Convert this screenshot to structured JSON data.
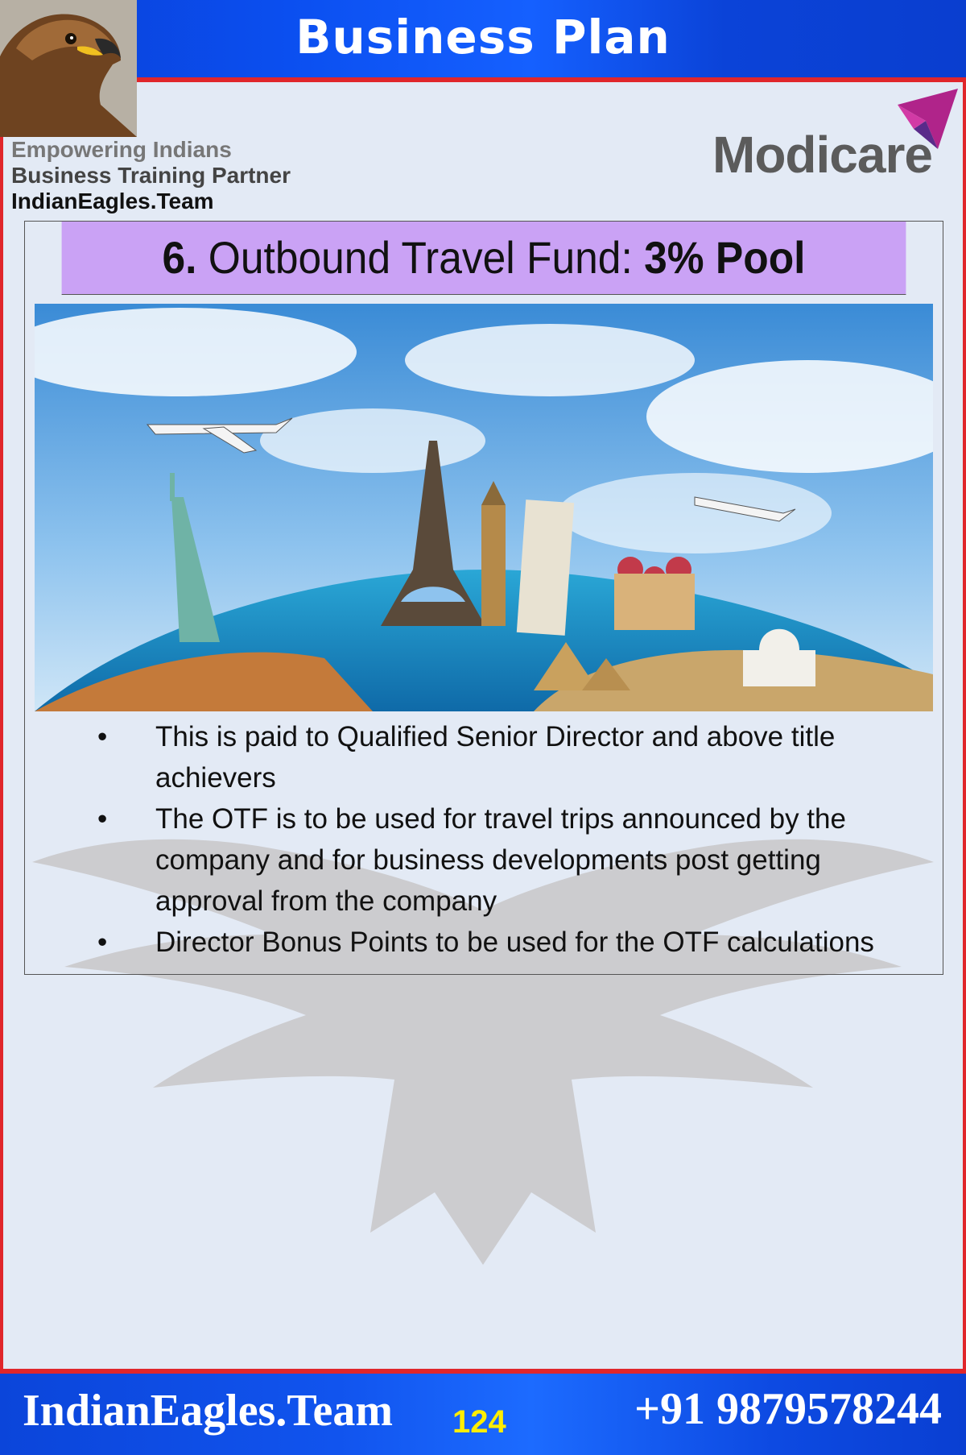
{
  "header": {
    "title": "Business Plan"
  },
  "branding": {
    "line1": "Empowering Indians",
    "line2": "Business Training Partner",
    "line3": "IndianEagles.Team",
    "logo_text": "Modicare"
  },
  "slide": {
    "title_number": "6.",
    "title_main": "Outbound Travel Fund:",
    "title_bold": "3% Pool",
    "bullets": [
      "This is paid to Qualified Senior Director and above title achievers",
      "The OTF is to be used for travel trips announced by the company and for business developments post getting approval from the company",
      "Director Bonus Points to be used for the OTF calculations"
    ]
  },
  "footer": {
    "site": "IndianEagles.Team",
    "page_number": "124",
    "phone": "+91 9879578244"
  },
  "colors": {
    "header_blue": "#0b4ff0",
    "accent_red": "#e0262b",
    "title_bar_purple": "#caa2f5",
    "page_number_yellow": "#ffee00"
  },
  "icons": [
    "eagle-photo",
    "modicare-logo-icon",
    "travel-landmarks-image",
    "eagle-watermark"
  ]
}
